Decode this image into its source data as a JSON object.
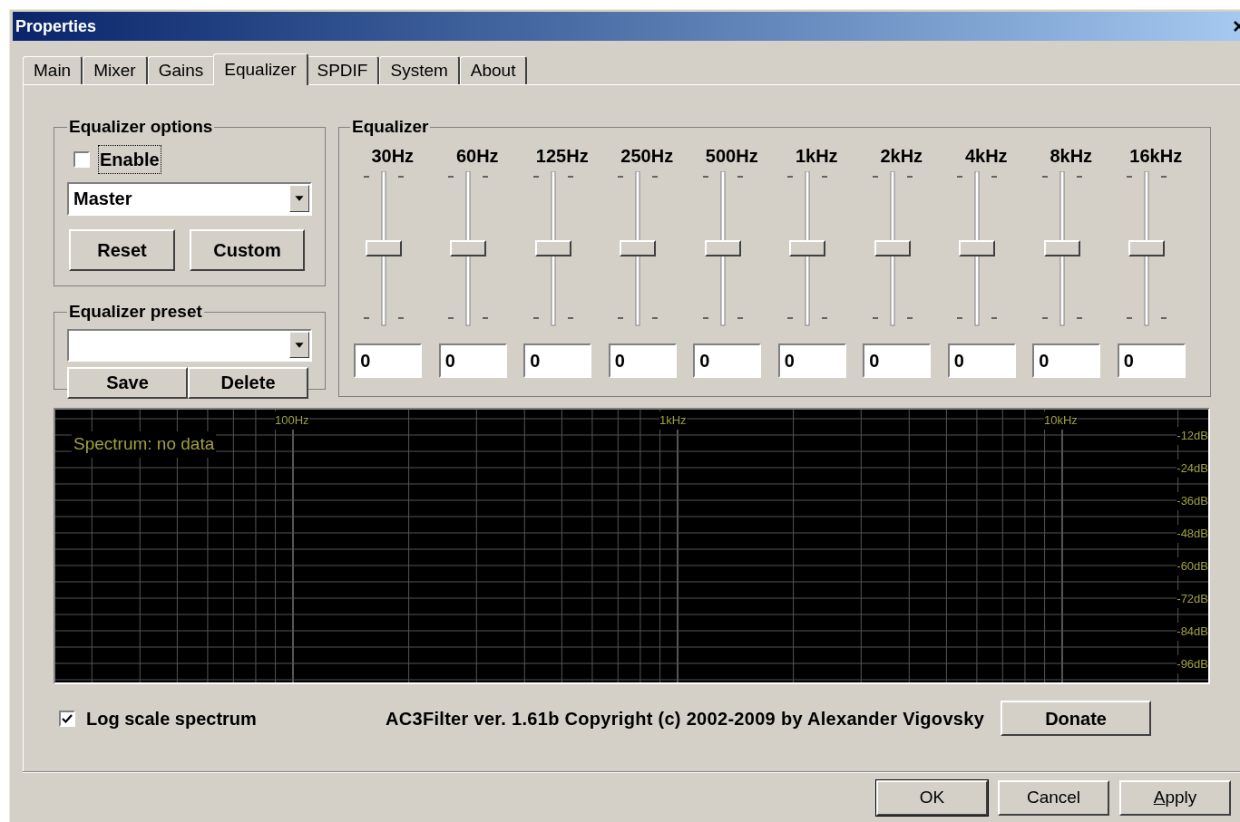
{
  "window": {
    "title": "Properties"
  },
  "tabs": [
    {
      "label": "Main",
      "selected": false
    },
    {
      "label": "Mixer",
      "selected": false
    },
    {
      "label": "Gains",
      "selected": false
    },
    {
      "label": "Equalizer",
      "selected": true
    },
    {
      "label": "SPDIF",
      "selected": false
    },
    {
      "label": "System",
      "selected": false
    },
    {
      "label": "About",
      "selected": false
    }
  ],
  "eq_options": {
    "title": "Equalizer options",
    "enable": {
      "label": "Enable",
      "checked": false,
      "focused": true
    },
    "channel": "Master",
    "buttons": [
      "Reset",
      "Custom"
    ]
  },
  "eq_preset": {
    "title": "Equalizer preset",
    "buttons": [
      "Save",
      "Delete"
    ]
  },
  "equalizer": {
    "title": "Equalizer",
    "bands": [
      {
        "label": "30Hz",
        "level": 0.5,
        "value": "0"
      },
      {
        "label": "60Hz",
        "level": 0.5,
        "value": "0"
      },
      {
        "label": "125Hz",
        "level": 0.5,
        "value": "0"
      },
      {
        "label": "250Hz",
        "level": 0.5,
        "value": "0"
      },
      {
        "label": "500Hz",
        "level": 0.5,
        "value": "0"
      },
      {
        "label": "1kHz",
        "level": 0.5,
        "value": "0"
      },
      {
        "label": "2kHz",
        "level": 0.5,
        "value": "0"
      },
      {
        "label": "4kHz",
        "level": 0.5,
        "value": "0"
      },
      {
        "label": "8kHz",
        "level": 0.5,
        "value": "0"
      },
      {
        "label": "16kHz",
        "level": 0.5,
        "value": "0"
      }
    ]
  },
  "spectrum": {
    "status": "Spectrum: no data",
    "freq_labels": [
      "100Hz",
      "1kHz",
      "10kHz"
    ],
    "db_labels": [
      "-12dB",
      "-24dB",
      "-36dB",
      "-48dB",
      "-60dB",
      "-72dB",
      "-84dB",
      "-96dB"
    ]
  },
  "log_scale": {
    "label": "Log scale spectrum",
    "checked": true
  },
  "copyright": "AC3Filter ver. 1.61b Copyright (c) 2002-2009 by Alexander Vigovsky",
  "donate": "Donate",
  "buttons": [
    {
      "label": "OK",
      "default": true,
      "underline_first": false
    },
    {
      "label": "Cancel",
      "default": false,
      "underline_first": false
    },
    {
      "label": "Apply",
      "default": false,
      "underline_first": true
    }
  ]
}
